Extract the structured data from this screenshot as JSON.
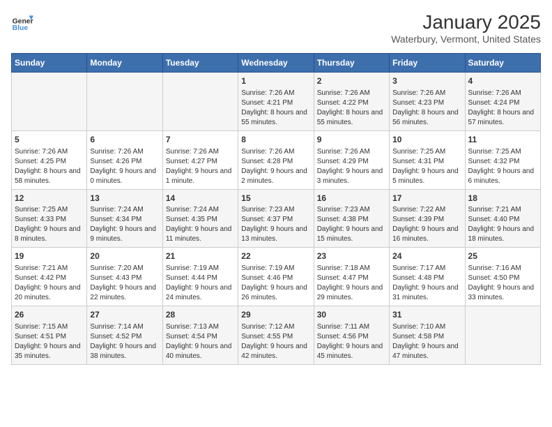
{
  "header": {
    "logo_general": "General",
    "logo_blue": "Blue",
    "title": "January 2025",
    "subtitle": "Waterbury, Vermont, United States"
  },
  "weekdays": [
    "Sunday",
    "Monday",
    "Tuesday",
    "Wednesday",
    "Thursday",
    "Friday",
    "Saturday"
  ],
  "weeks": [
    [
      {
        "day": "",
        "info": ""
      },
      {
        "day": "",
        "info": ""
      },
      {
        "day": "",
        "info": ""
      },
      {
        "day": "1",
        "info": "Sunrise: 7:26 AM\nSunset: 4:21 PM\nDaylight: 8 hours and 55 minutes."
      },
      {
        "day": "2",
        "info": "Sunrise: 7:26 AM\nSunset: 4:22 PM\nDaylight: 8 hours and 55 minutes."
      },
      {
        "day": "3",
        "info": "Sunrise: 7:26 AM\nSunset: 4:23 PM\nDaylight: 8 hours and 56 minutes."
      },
      {
        "day": "4",
        "info": "Sunrise: 7:26 AM\nSunset: 4:24 PM\nDaylight: 8 hours and 57 minutes."
      }
    ],
    [
      {
        "day": "5",
        "info": "Sunrise: 7:26 AM\nSunset: 4:25 PM\nDaylight: 8 hours and 58 minutes."
      },
      {
        "day": "6",
        "info": "Sunrise: 7:26 AM\nSunset: 4:26 PM\nDaylight: 9 hours and 0 minutes."
      },
      {
        "day": "7",
        "info": "Sunrise: 7:26 AM\nSunset: 4:27 PM\nDaylight: 9 hours and 1 minute."
      },
      {
        "day": "8",
        "info": "Sunrise: 7:26 AM\nSunset: 4:28 PM\nDaylight: 9 hours and 2 minutes."
      },
      {
        "day": "9",
        "info": "Sunrise: 7:26 AM\nSunset: 4:29 PM\nDaylight: 9 hours and 3 minutes."
      },
      {
        "day": "10",
        "info": "Sunrise: 7:25 AM\nSunset: 4:31 PM\nDaylight: 9 hours and 5 minutes."
      },
      {
        "day": "11",
        "info": "Sunrise: 7:25 AM\nSunset: 4:32 PM\nDaylight: 9 hours and 6 minutes."
      }
    ],
    [
      {
        "day": "12",
        "info": "Sunrise: 7:25 AM\nSunset: 4:33 PM\nDaylight: 9 hours and 8 minutes."
      },
      {
        "day": "13",
        "info": "Sunrise: 7:24 AM\nSunset: 4:34 PM\nDaylight: 9 hours and 9 minutes."
      },
      {
        "day": "14",
        "info": "Sunrise: 7:24 AM\nSunset: 4:35 PM\nDaylight: 9 hours and 11 minutes."
      },
      {
        "day": "15",
        "info": "Sunrise: 7:23 AM\nSunset: 4:37 PM\nDaylight: 9 hours and 13 minutes."
      },
      {
        "day": "16",
        "info": "Sunrise: 7:23 AM\nSunset: 4:38 PM\nDaylight: 9 hours and 15 minutes."
      },
      {
        "day": "17",
        "info": "Sunrise: 7:22 AM\nSunset: 4:39 PM\nDaylight: 9 hours and 16 minutes."
      },
      {
        "day": "18",
        "info": "Sunrise: 7:21 AM\nSunset: 4:40 PM\nDaylight: 9 hours and 18 minutes."
      }
    ],
    [
      {
        "day": "19",
        "info": "Sunrise: 7:21 AM\nSunset: 4:42 PM\nDaylight: 9 hours and 20 minutes."
      },
      {
        "day": "20",
        "info": "Sunrise: 7:20 AM\nSunset: 4:43 PM\nDaylight: 9 hours and 22 minutes."
      },
      {
        "day": "21",
        "info": "Sunrise: 7:19 AM\nSunset: 4:44 PM\nDaylight: 9 hours and 24 minutes."
      },
      {
        "day": "22",
        "info": "Sunrise: 7:19 AM\nSunset: 4:46 PM\nDaylight: 9 hours and 26 minutes."
      },
      {
        "day": "23",
        "info": "Sunrise: 7:18 AM\nSunset: 4:47 PM\nDaylight: 9 hours and 29 minutes."
      },
      {
        "day": "24",
        "info": "Sunrise: 7:17 AM\nSunset: 4:48 PM\nDaylight: 9 hours and 31 minutes."
      },
      {
        "day": "25",
        "info": "Sunrise: 7:16 AM\nSunset: 4:50 PM\nDaylight: 9 hours and 33 minutes."
      }
    ],
    [
      {
        "day": "26",
        "info": "Sunrise: 7:15 AM\nSunset: 4:51 PM\nDaylight: 9 hours and 35 minutes."
      },
      {
        "day": "27",
        "info": "Sunrise: 7:14 AM\nSunset: 4:52 PM\nDaylight: 9 hours and 38 minutes."
      },
      {
        "day": "28",
        "info": "Sunrise: 7:13 AM\nSunset: 4:54 PM\nDaylight: 9 hours and 40 minutes."
      },
      {
        "day": "29",
        "info": "Sunrise: 7:12 AM\nSunset: 4:55 PM\nDaylight: 9 hours and 42 minutes."
      },
      {
        "day": "30",
        "info": "Sunrise: 7:11 AM\nSunset: 4:56 PM\nDaylight: 9 hours and 45 minutes."
      },
      {
        "day": "31",
        "info": "Sunrise: 7:10 AM\nSunset: 4:58 PM\nDaylight: 9 hours and 47 minutes."
      },
      {
        "day": "",
        "info": ""
      }
    ]
  ]
}
